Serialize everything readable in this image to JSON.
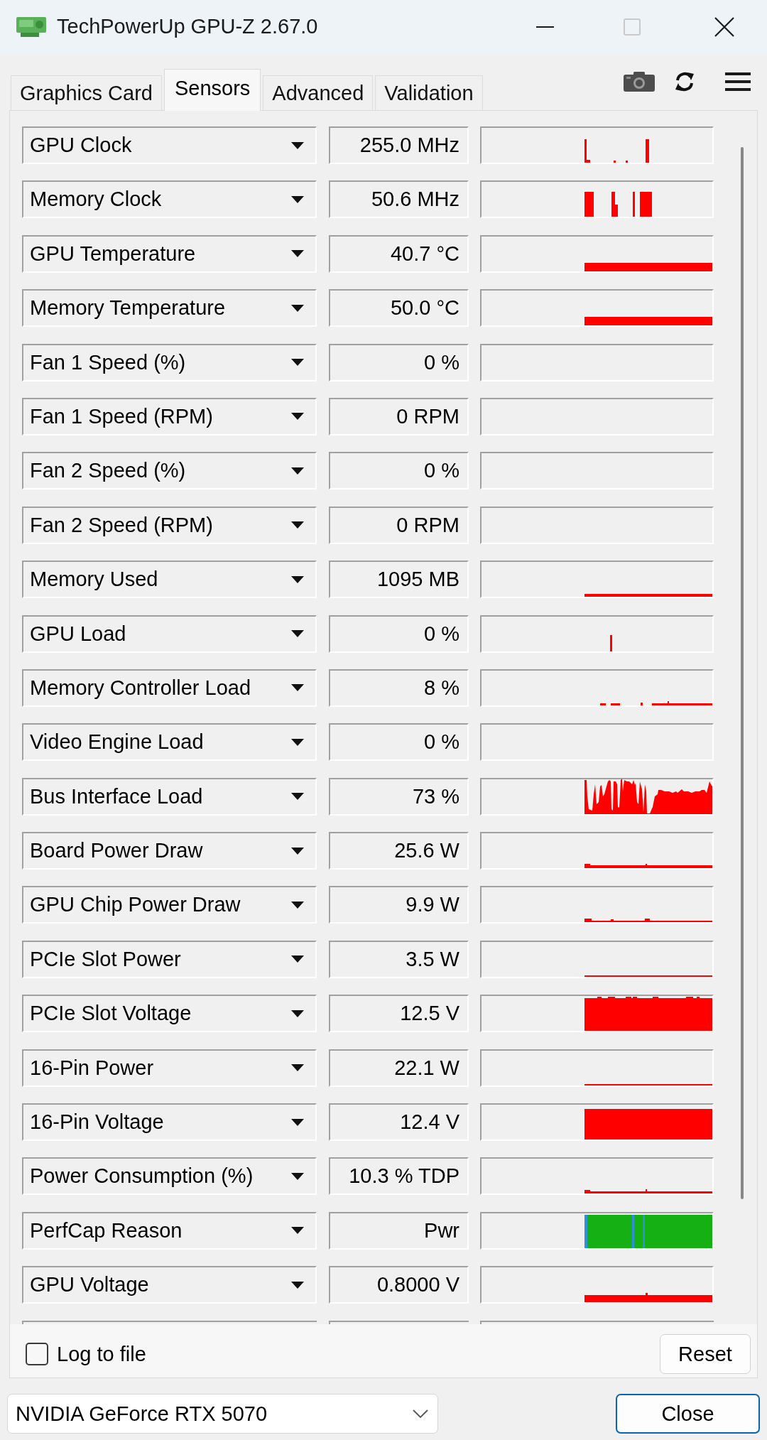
{
  "window": {
    "title": "TechPowerUp GPU-Z 2.67.0",
    "maximize_disabled": true
  },
  "tabs": [
    {
      "label": "Graphics Card",
      "selected": false
    },
    {
      "label": "Sensors",
      "selected": true
    },
    {
      "label": "Advanced",
      "selected": false
    },
    {
      "label": "Validation",
      "selected": false
    }
  ],
  "sensors": [
    {
      "name": "GPU Clock",
      "value": "255.0 MHz"
    },
    {
      "name": "Memory Clock",
      "value": "50.6 MHz"
    },
    {
      "name": "GPU Temperature",
      "value": "40.7 °C"
    },
    {
      "name": "Memory Temperature",
      "value": "50.0 °C"
    },
    {
      "name": "Fan 1 Speed (%)",
      "value": "0 %"
    },
    {
      "name": "Fan 1 Speed (RPM)",
      "value": "0 RPM"
    },
    {
      "name": "Fan 2 Speed (%)",
      "value": "0 %"
    },
    {
      "name": "Fan 2 Speed (RPM)",
      "value": "0 RPM"
    },
    {
      "name": "Memory Used",
      "value": "1095 MB"
    },
    {
      "name": "GPU Load",
      "value": "0 %"
    },
    {
      "name": "Memory Controller Load",
      "value": "8 %"
    },
    {
      "name": "Video Engine Load",
      "value": "0 %"
    },
    {
      "name": "Bus Interface Load",
      "value": "73 %"
    },
    {
      "name": "Board Power Draw",
      "value": "25.6 W"
    },
    {
      "name": "GPU Chip Power Draw",
      "value": "9.9 W"
    },
    {
      "name": "PCIe Slot Power",
      "value": "3.5 W"
    },
    {
      "name": "PCIe Slot Voltage",
      "value": "12.5 V"
    },
    {
      "name": "16-Pin Power",
      "value": "22.1 W"
    },
    {
      "name": "16-Pin Voltage",
      "value": "12.4 V"
    },
    {
      "name": "Power Consumption (%)",
      "value": "10.3 % TDP"
    },
    {
      "name": "PerfCap Reason",
      "value": "Pwr"
    },
    {
      "name": "GPU Voltage",
      "value": "0.8000 V"
    }
  ],
  "log_to_file": {
    "label": "Log to file",
    "checked": false
  },
  "reset_button": {
    "label": "Reset"
  },
  "device_select": {
    "value": "NVIDIA GeForce RTX 5070"
  },
  "close_button": {
    "label": "Close",
    "default": true
  }
}
